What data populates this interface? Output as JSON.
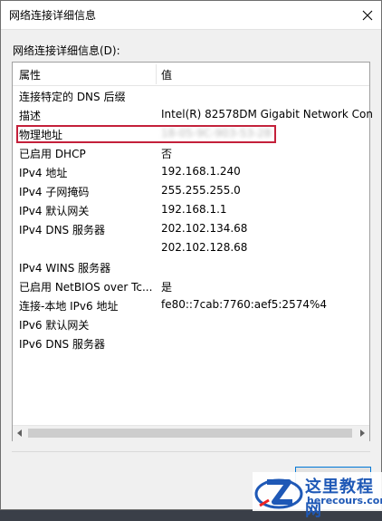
{
  "window": {
    "title": "网络连接详细信息"
  },
  "group_label": "网络连接详细信息(D):",
  "columns": {
    "property": "属性",
    "value": "值"
  },
  "rows": [
    {
      "property": "连接特定的 DNS 后缀",
      "value": ""
    },
    {
      "property": "描述",
      "value": "Intel(R) 82578DM Gigabit Network Con"
    },
    {
      "property": "物理地址",
      "value": "18-05-9C-903-53-28",
      "blurred": true,
      "highlighted": true
    },
    {
      "property": "已启用 DHCP",
      "value": "否"
    },
    {
      "property": "IPv4 地址",
      "value": "192.168.1.240"
    },
    {
      "property": "IPv4 子网掩码",
      "value": "255.255.255.0"
    },
    {
      "property": "IPv4 默认网关",
      "value": "192.168.1.1"
    },
    {
      "property": "IPv4 DNS 服务器",
      "value": "202.102.134.68"
    },
    {
      "property": "",
      "value": "202.102.128.68"
    },
    {
      "property": "IPv4 WINS 服务器",
      "value": ""
    },
    {
      "property": "已启用 NetBIOS over Tc...",
      "value": "是"
    },
    {
      "property": "连接-本地 IPv6 地址",
      "value": "fe80::7cab:7760:aef5:2574%4"
    },
    {
      "property": "IPv6 默认网关",
      "value": ""
    },
    {
      "property": "IPv6 DNS 服务器",
      "value": ""
    }
  ],
  "buttons": {
    "close_label": ""
  },
  "watermark": {
    "line1": "这里教程网",
    "line2": "herecours.com"
  },
  "colors": {
    "highlight": "#c4203a",
    "watermark": "#1e58b6",
    "accent": "#0078d7"
  }
}
